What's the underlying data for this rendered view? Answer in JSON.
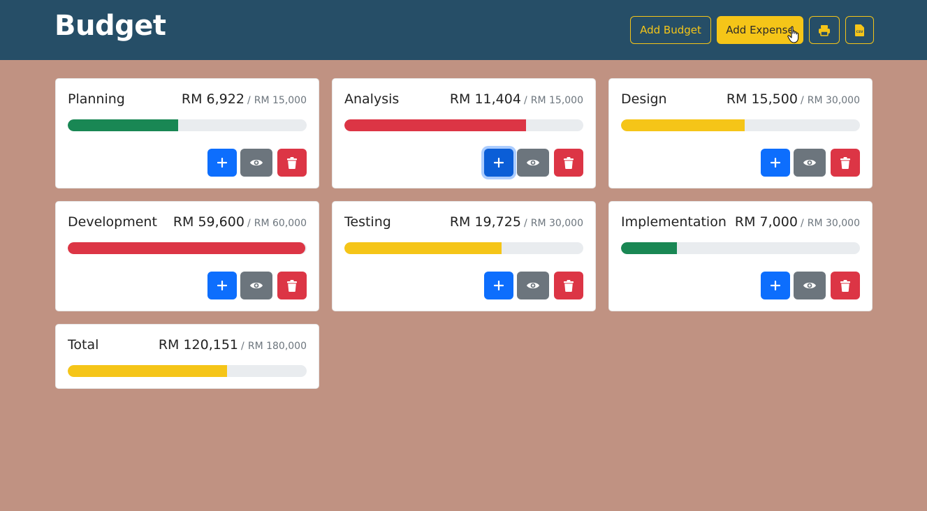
{
  "header": {
    "title": "Budget",
    "add_budget_label": "Add Budget",
    "add_expense_label": "Add Expense",
    "print_icon": "print-icon",
    "csv_icon": "csv-file-icon",
    "csv_text": "CSV"
  },
  "colors": {
    "header_bg": "#264e67",
    "page_bg": "#c09282",
    "accent": "#f5c518",
    "success": "#198754",
    "danger": "#dc3545",
    "warning": "#f5c518",
    "primary": "#0d6efd",
    "secondary": "#6c757d"
  },
  "budgets": [
    {
      "name": "Planning",
      "amount": "RM 6,922",
      "limit": "RM 15,000",
      "progress": 0.4615,
      "status": "success"
    },
    {
      "name": "Analysis",
      "amount": "RM 11,404",
      "limit": "RM 15,000",
      "progress": 0.7603,
      "status": "danger"
    },
    {
      "name": "Design",
      "amount": "RM 15,500",
      "limit": "RM 30,000",
      "progress": 0.5167,
      "status": "warning"
    },
    {
      "name": "Development",
      "amount": "RM 59,600",
      "limit": "RM 60,000",
      "progress": 0.9933,
      "status": "danger"
    },
    {
      "name": "Testing",
      "amount": "RM 19,725",
      "limit": "RM 30,000",
      "progress": 0.6575,
      "status": "warning"
    },
    {
      "name": "Implementation",
      "amount": "RM 7,000",
      "limit": "RM 30,000",
      "progress": 0.2333,
      "status": "success"
    }
  ],
  "total": {
    "name": "Total",
    "amount": "RM 120,151",
    "limit": "RM 180,000",
    "progress": 0.6675,
    "status": "warning"
  },
  "card_actions": {
    "add_icon": "plus-icon",
    "view_icon": "eye-icon",
    "delete_icon": "trash-icon"
  },
  "separator": "/"
}
